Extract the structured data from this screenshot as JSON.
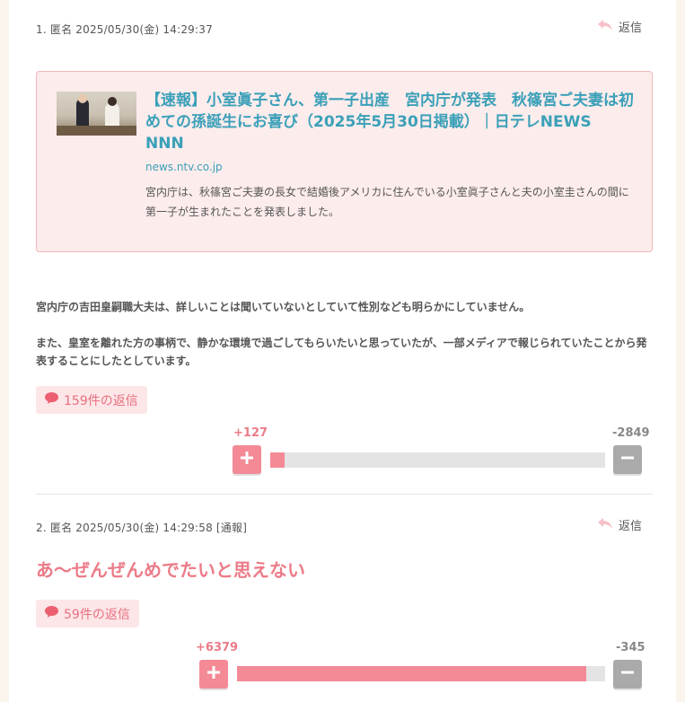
{
  "posts": [
    {
      "meta": "1. 匿名 2025/05/30(金) 14:29:37",
      "reply_label": "返信",
      "link_card": {
        "title": "【速報】小室眞子さん、第一子出産　宮内庁が発表　秋篠宮ご夫妻は初めての孫誕生にお喜び（2025年5月30日掲載）｜日テレNEWS NNN",
        "domain": "news.ntv.co.jp",
        "description": "宮内庁は、秋篠宮ご夫妻の長女で結婚後アメリカに住んでいる小室眞子さんと夫の小室圭さんの間に第一子が生まれたことを発表しました。"
      },
      "paragraphs": [
        "宮内庁の吉田皇嗣職大夫は、詳しいことは聞いていないとしていて性別なども明らかにしていません。",
        "また、皇室を離れた方の事柄で、静かな環境で過ごしてもらいたいと思っていたが、一部メディアで報じられていたことから発表することにしたとしています。"
      ],
      "replies_label": "159件の返信",
      "plus_score": "+127",
      "minus_score": "-2849",
      "plus_ratio": 0.043
    },
    {
      "meta": "2. 匿名 2025/05/30(金) 14:29:58 [通報]",
      "reply_label": "返信",
      "headline": "あ〜ぜんぜんめでたいと思えない",
      "replies_label": "59件の返信",
      "plus_score": "+6379",
      "minus_score": "-345",
      "plus_ratio": 0.949
    }
  ],
  "colors": {
    "accent_pink": "#ec7b88",
    "link_teal": "#3aa0b8",
    "card_bg": "#fdecec"
  },
  "icons": {
    "reply": "reply-arrow-icon",
    "comment": "speech-bubble-icon",
    "plus": "plus-icon",
    "minus": "minus-icon"
  }
}
